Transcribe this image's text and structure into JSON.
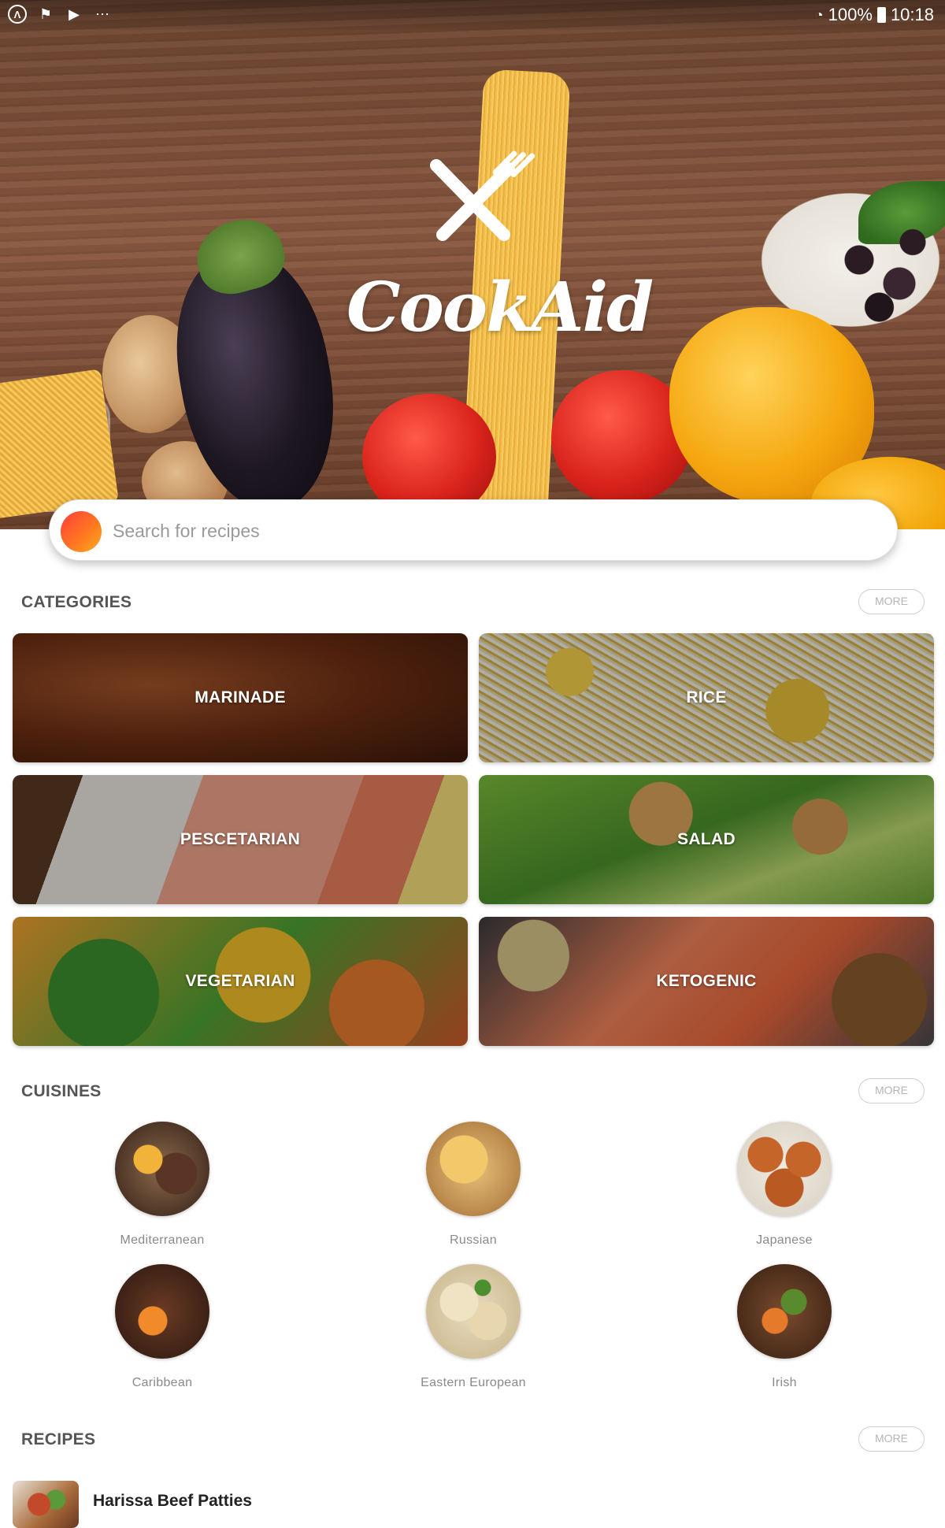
{
  "status_bar": {
    "left_icons": [
      "app-icon-a",
      "flag-icon",
      "play-store-icon",
      "more-dots-icon"
    ],
    "battery": "100%",
    "time": "10:18"
  },
  "hero": {
    "app_name": "CookAid",
    "logo_icon": "fork-knife-icon"
  },
  "search": {
    "placeholder": "Search for recipes",
    "value": ""
  },
  "categories": {
    "title": "CATEGORIES",
    "more_label": "MORE",
    "items": [
      {
        "label": "MARINADE"
      },
      {
        "label": "RICE"
      },
      {
        "label": "PESCETARIAN"
      },
      {
        "label": "SALAD"
      },
      {
        "label": "VEGETARIAN"
      },
      {
        "label": "KETOGENIC"
      }
    ]
  },
  "cuisines": {
    "title": "CUISINES",
    "more_label": "MORE",
    "items": [
      {
        "name": "Mediterranean"
      },
      {
        "name": "Russian"
      },
      {
        "name": "Japanese"
      },
      {
        "name": "Caribbean"
      },
      {
        "name": "Eastern European"
      },
      {
        "name": "Irish"
      }
    ]
  },
  "recipes": {
    "title": "RECIPES",
    "more_label": "MORE",
    "items": [
      {
        "title": "Harissa Beef Patties"
      }
    ]
  },
  "colors": {
    "accent_gradient_start": "#ff3d3d",
    "accent_gradient_end": "#ffb020",
    "section_title": "#555555",
    "muted_text": "#8a8a8a"
  }
}
